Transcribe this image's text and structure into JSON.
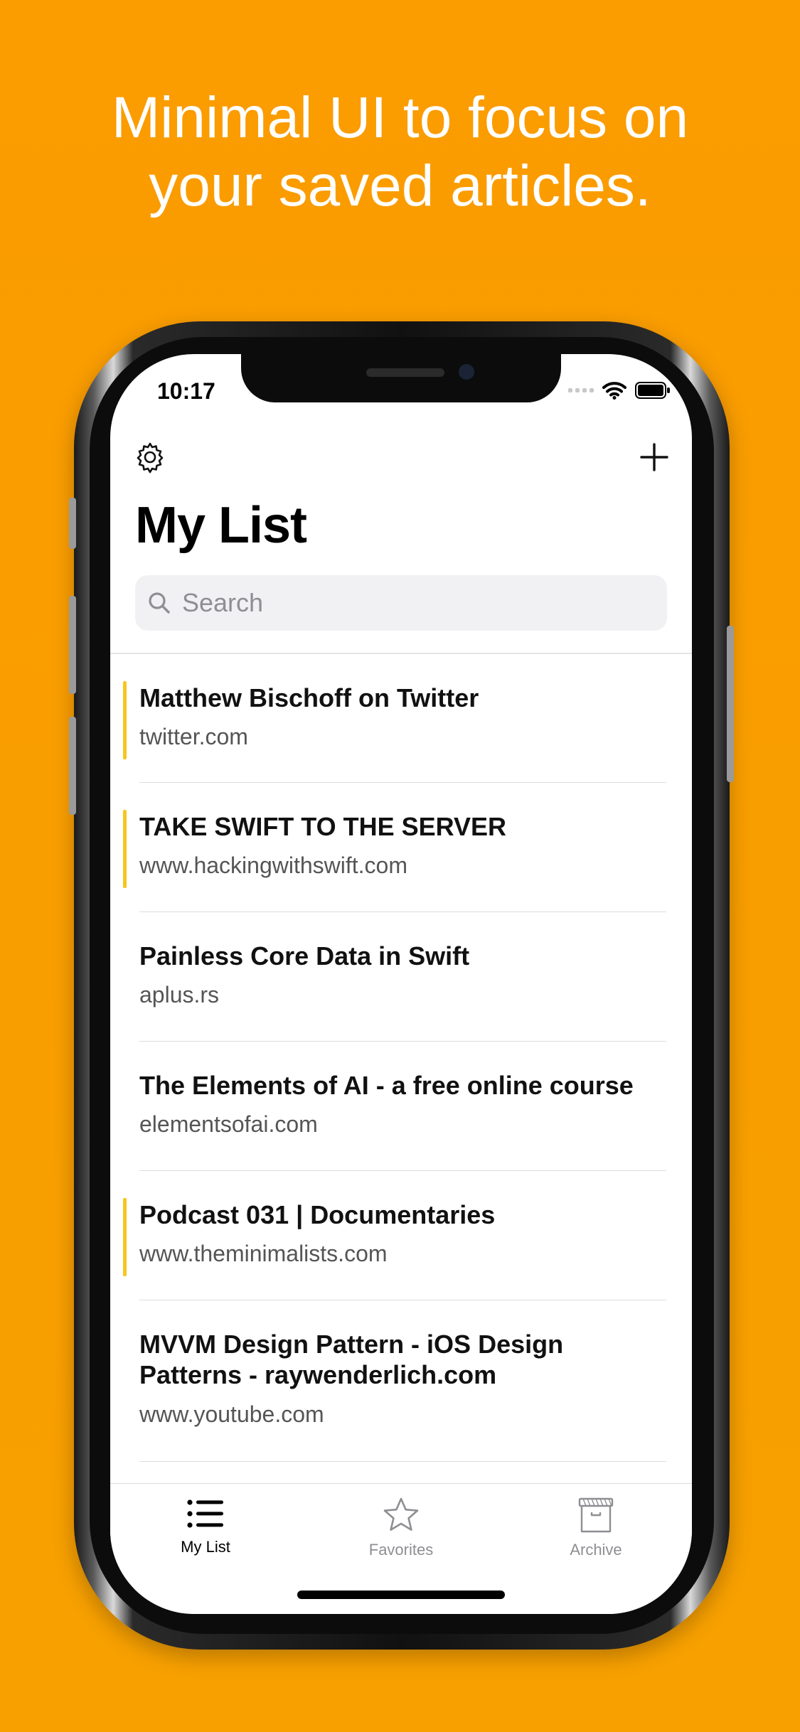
{
  "headline": {
    "line1": "Minimal UI to focus on",
    "line2": "your saved articles."
  },
  "status_bar": {
    "time": "10:17"
  },
  "toolbar": {
    "settings_icon": "gear-icon",
    "add_icon": "plus-icon"
  },
  "page_title": "My List",
  "search": {
    "placeholder": "Search",
    "value": ""
  },
  "articles": [
    {
      "title": "Matthew Bischoff on Twitter",
      "domain": "twitter.com",
      "unread": true
    },
    {
      "title": "TAKE SWIFT TO THE SERVER",
      "domain": "www.hackingwithswift.com",
      "unread": true
    },
    {
      "title": "Painless Core Data in Swift",
      "domain": "aplus.rs",
      "unread": false
    },
    {
      "title": "The Elements of AI - a free online course",
      "domain": "elementsofai.com",
      "unread": false
    },
    {
      "title": "Podcast 031 | Documentaries",
      "domain": "www.theminimalists.com",
      "unread": true
    },
    {
      "title": "MVVM Design Pattern - iOS Design Patterns - raywenderlich.com",
      "domain": "www.youtube.com",
      "unread": false
    }
  ],
  "tabs": [
    {
      "label": "My List",
      "icon": "list-icon",
      "active": true
    },
    {
      "label": "Favorites",
      "icon": "star-icon",
      "active": false
    },
    {
      "label": "Archive",
      "icon": "archive-box-icon",
      "active": false
    }
  ],
  "colors": {
    "background": "#FB9C00",
    "unread_marker": "#F7C61E",
    "tab_active": "#000000",
    "tab_inactive": "#8e8e93"
  }
}
